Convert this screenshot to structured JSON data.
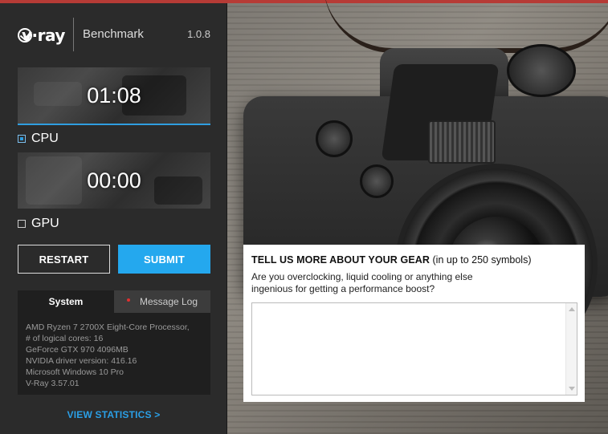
{
  "app": {
    "logo_text": "v·ray",
    "product": "Benchmark",
    "version": "1.0.8"
  },
  "cpu": {
    "timer": "01:08",
    "label": "CPU",
    "checked": true
  },
  "gpu": {
    "timer": "00:00",
    "label": "GPU",
    "checked": false
  },
  "buttons": {
    "restart": "RESTART",
    "submit": "SUBMIT"
  },
  "tabs": {
    "system": "System",
    "message_log": "Message Log"
  },
  "system_info": [
    "AMD Ryzen 7 2700X Eight-Core Processor,",
    "# of logical cores: 16",
    "GeForce GTX 970 4096MB",
    "NVIDIA driver version: 416.16",
    "Microsoft Windows 10 Pro",
    "V-Ray 3.57.01"
  ],
  "view_statistics": "VIEW STATISTICS >",
  "gear": {
    "title": "TELL US MORE ABOUT YOUR GEAR",
    "title_suffix": "(in up to 250 symbols)",
    "description": "Are you overclocking, liquid cooling or anything else ingenious for getting a performance boost?",
    "textarea_value": ""
  },
  "colors": {
    "accent_blue": "#24a8ee",
    "panel_bg": "#2b2b2b",
    "top_bar_red": "#b63b36",
    "message_dot_red": "#e03030"
  },
  "icons": {
    "cpu_checkbox": "checkbox-checked",
    "gpu_checkbox": "checkbox-unchecked",
    "log_indicator": "red-dot"
  }
}
